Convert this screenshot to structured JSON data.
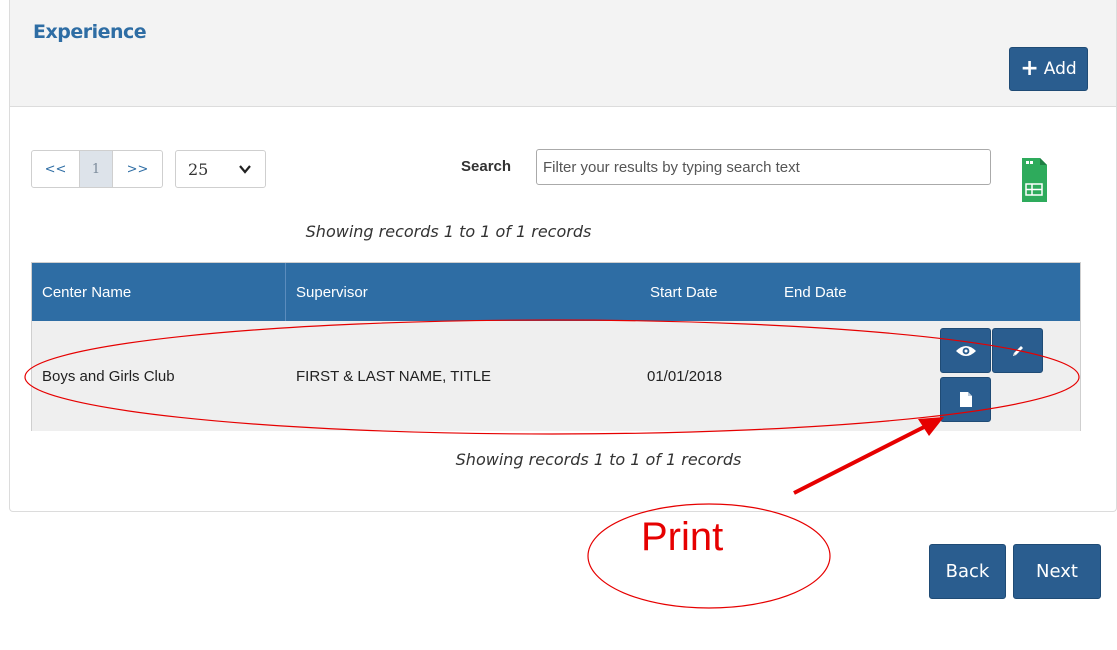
{
  "panel": {
    "title": "Experience",
    "add_label": "Add"
  },
  "pagination": {
    "prev": "<<",
    "current": "1",
    "next": ">>",
    "page_size": "25"
  },
  "search": {
    "label": "Search",
    "placeholder": "Filter your results by typing search text"
  },
  "records": {
    "showing_top": "Showing records 1 to 1 of 1 records",
    "showing_bottom": "Showing records 1 to 1 of 1 records"
  },
  "table": {
    "columns": [
      "Center Name",
      "Supervisor",
      "Start Date",
      "End Date"
    ],
    "rows": [
      {
        "center_name": "Boys and Girls Club",
        "supervisor": "FIRST & LAST NAME, TITLE",
        "start_date": "01/01/2018",
        "end_date": ""
      }
    ]
  },
  "footer": {
    "back_label": "Back",
    "next_label": "Next"
  },
  "annotation": {
    "callout_text": "Print",
    "color": "#e60000"
  },
  "colors": {
    "primary": "#2e6da4",
    "button": "#2a5d8f",
    "spreadsheet_icon": "#2eab5c"
  },
  "icons": {
    "add": "plus-icon",
    "page_size": "chevron-down-icon",
    "export": "spreadsheet-icon",
    "view": "eye-icon",
    "edit": "pencil-icon",
    "print": "document-icon"
  }
}
